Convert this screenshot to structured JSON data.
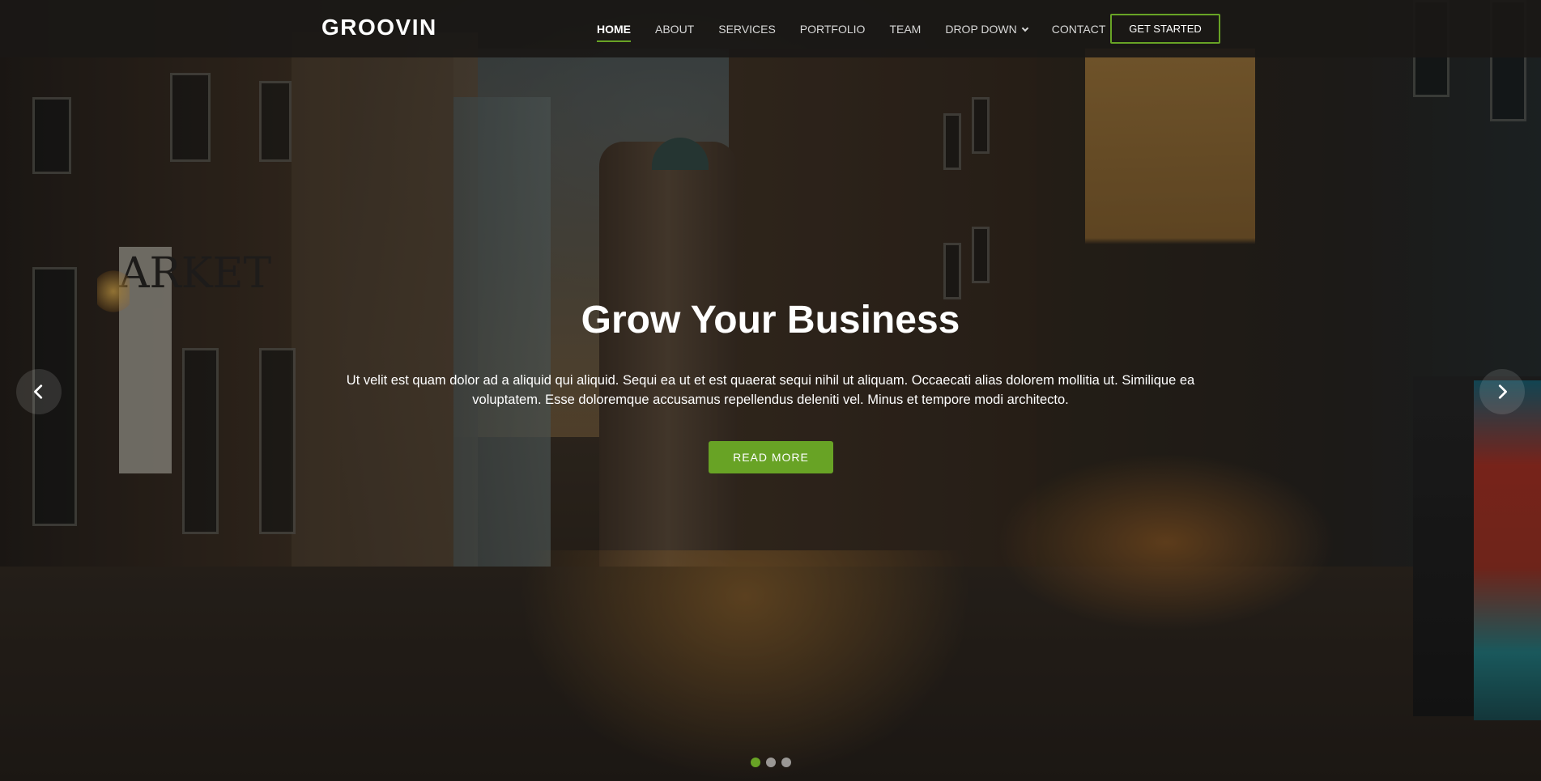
{
  "brand": {
    "logo": "GROOVIN"
  },
  "nav": {
    "items": [
      {
        "label": "HOME",
        "active": true
      },
      {
        "label": "ABOUT"
      },
      {
        "label": "SERVICES"
      },
      {
        "label": "PORTFOLIO"
      },
      {
        "label": "TEAM"
      },
      {
        "label": "DROP DOWN",
        "has_dropdown": true
      },
      {
        "label": "CONTACT"
      }
    ],
    "cta_label": "GET STARTED"
  },
  "hero": {
    "title": "Grow Your Business",
    "text": "Ut velit est quam dolor ad a aliquid qui aliquid. Sequi ea ut et est quaerat sequi nihil ut aliquam. Occaecati alias dolorem mollitia ut. Similique ea voluptatem. Esse doloremque accusamus repellendus deleniti vel. Minus et tempore modi architecto.",
    "button_label": "READ MORE",
    "sign_text": "ARKET"
  },
  "carousel": {
    "slides": 3,
    "active_slide": 1,
    "prev_icon": "chevron-left-icon",
    "next_icon": "chevron-right-icon"
  },
  "colors": {
    "accent": "#68a325",
    "header_bg": "#1a1816",
    "text": "#ffffff"
  }
}
